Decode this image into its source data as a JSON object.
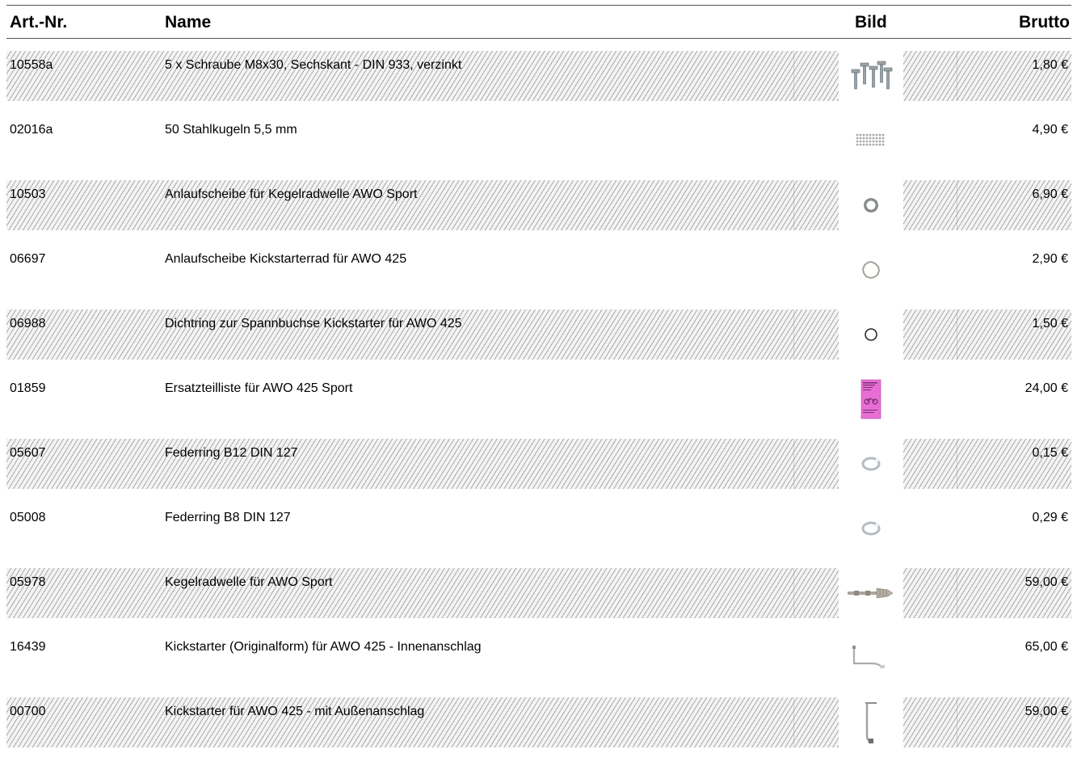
{
  "header": {
    "art_nr": "Art.-Nr.",
    "name": "Name",
    "bild": "Bild",
    "brutto": "Brutto"
  },
  "rows": [
    {
      "art_nr": "10558a",
      "name": "5 x Schraube M8x30, Sechskant - DIN 933, verzinkt",
      "price": "1,80 €",
      "image_icon": "bolts-icon",
      "striped": true
    },
    {
      "art_nr": "02016a",
      "name": "50 Stahlkugeln 5,5 mm",
      "price": "4,90 €",
      "image_icon": "steel-balls-icon",
      "striped": false
    },
    {
      "art_nr": "10503",
      "name": "Anlaufscheibe für Kegelradwelle AWO Sport",
      "price": "6,90 €",
      "image_icon": "thrust-washer-icon",
      "striped": true
    },
    {
      "art_nr": "06697",
      "name": "Anlaufscheibe Kickstarterrad für AWO 425",
      "price": "2,90 €",
      "image_icon": "toothed-washer-icon",
      "striped": false
    },
    {
      "art_nr": "06988",
      "name": "Dichtring zur Spannbuchse Kickstarter für AWO 425",
      "price": "1,50 €",
      "image_icon": "o-ring-icon",
      "striped": true
    },
    {
      "art_nr": "01859",
      "name": "Ersatzteilliste für AWO 425 Sport",
      "price": "24,00 €",
      "image_icon": "booklet-icon",
      "striped": false
    },
    {
      "art_nr": "05607",
      "name": "Federring B12 DIN 127",
      "price": "0,15 €",
      "image_icon": "spring-washer-icon",
      "striped": true
    },
    {
      "art_nr": "05008",
      "name": "Federring B8 DIN 127",
      "price": "0,29 €",
      "image_icon": "spring-washer-icon",
      "striped": false
    },
    {
      "art_nr": "05978",
      "name": "Kegelradwelle für AWO Sport",
      "price": "59,00 €",
      "image_icon": "shaft-icon",
      "striped": true
    },
    {
      "art_nr": "16439",
      "name": "Kickstarter (Originalform) für AWO 425 - Innenanschlag",
      "price": "65,00 €",
      "image_icon": "kickstarter-lever-icon",
      "striped": false
    },
    {
      "art_nr": "00700",
      "name": "Kickstarter für AWO 425 - mit Außenanschlag",
      "price": "59,00 €",
      "image_icon": "kickstarter-lever-vertical-icon",
      "striped": true
    }
  ]
}
